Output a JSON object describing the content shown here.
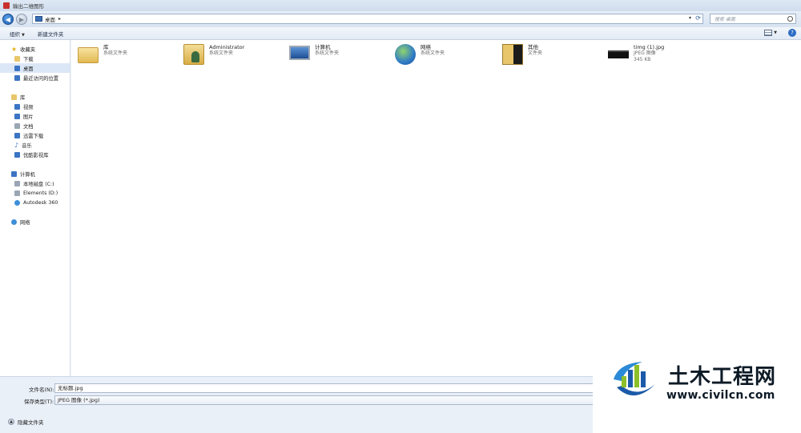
{
  "window": {
    "title": "输出二维图形"
  },
  "address": {
    "location": "桌面",
    "search_placeholder": "搜索 桌面"
  },
  "toolbar": {
    "organize": "组织",
    "new_folder": "新建文件夹"
  },
  "sidebar": {
    "favorites": {
      "label": "收藏夹",
      "items": [
        "下载",
        "桌面",
        "最近访问的位置"
      ]
    },
    "libraries": {
      "label": "库",
      "items": [
        "视频",
        "图片",
        "文档",
        "迅雷下载",
        "音乐",
        "优酷影视库"
      ]
    },
    "computer": {
      "label": "计算机",
      "items": [
        "本地磁盘 (C:)",
        "Elements (D:)",
        "Autodesk 360"
      ]
    },
    "network": {
      "label": "网络"
    }
  },
  "files": [
    {
      "name": "库",
      "type": "系统文件夹"
    },
    {
      "name": "Administrator",
      "type": "系统文件夹"
    },
    {
      "name": "计算机",
      "type": "系统文件夹"
    },
    {
      "name": "网络",
      "type": "系统文件夹"
    },
    {
      "name": "其他",
      "type": "文件夹"
    },
    {
      "name": "timg (1).jpg",
      "type": "JPEG 图像",
      "size": "345 KB"
    }
  ],
  "form": {
    "filename_label": "文件名(N):",
    "filename_value": "无标题.jpg",
    "filetype_label": "保存类型(T):",
    "filetype_value": "JPEG 图像 (*.jpg)",
    "hide_folders": "隐藏文件夹"
  },
  "watermark": {
    "title": "土木工程网",
    "url": "www.civilcn.com"
  }
}
